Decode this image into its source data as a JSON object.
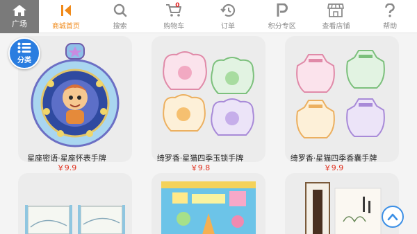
{
  "header": {
    "home_tab": {
      "label": "广场",
      "icon": "home-icon"
    },
    "nav": [
      {
        "label": "商城首页",
        "icon": "shop-home-icon",
        "active": true
      },
      {
        "label": "搜索",
        "icon": "search-icon"
      },
      {
        "label": "购物车",
        "icon": "cart-icon",
        "badge": "0"
      },
      {
        "label": "订单",
        "icon": "history-icon"
      },
      {
        "label": "积分专区",
        "icon": "points-p-icon"
      },
      {
        "label": "查看店铺",
        "icon": "store-icon"
      },
      {
        "label": "帮助",
        "icon": "help-icon"
      }
    ],
    "active_color": "#f08a1a"
  },
  "category_button": {
    "label": "分类",
    "icon": "list-icon",
    "color": "#2a7de0"
  },
  "products": [
    {
      "name": "星座密语·星座怀表手牌",
      "price": "￥9.9"
    },
    {
      "name": "绮罗香·星猫四季玉锁手牌",
      "price": "￥9.8"
    },
    {
      "name": "绮罗香·星猫四季香囊手牌",
      "price": "￥9.9"
    }
  ],
  "scroll_top_button": {
    "icon": "chevron-up-icon"
  },
  "price_color": "#e0301e"
}
